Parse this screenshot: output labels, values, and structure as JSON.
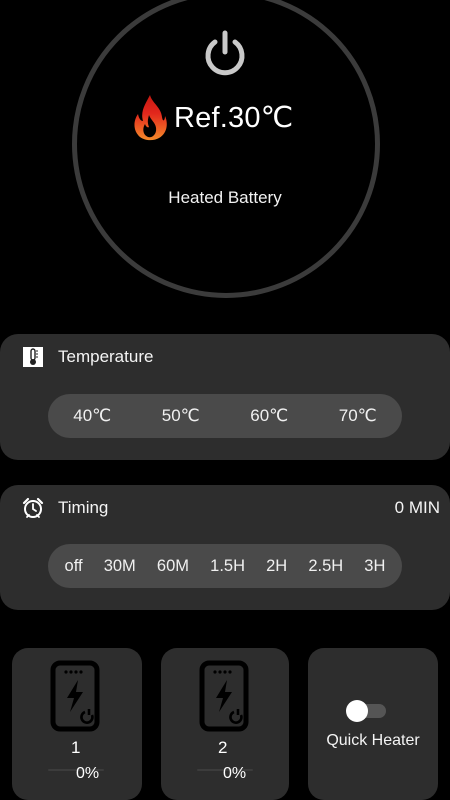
{
  "dial": {
    "reference_label": "Ref.30℃",
    "device_label": "Heated Battery",
    "power_icon": "power-icon",
    "flame_icon": "flame-icon",
    "ring_color": "#3b3b3b"
  },
  "temperature": {
    "title": "Temperature",
    "icon": "thermometer-icon",
    "options": [
      "40℃",
      "50℃",
      "60℃",
      "70℃"
    ]
  },
  "timing": {
    "title": "Timing",
    "icon": "alarm-clock-icon",
    "value": "0 MIN",
    "options": [
      "off",
      "30M",
      "60M",
      "1.5H",
      "2H",
      "2.5H",
      "3H"
    ]
  },
  "batteries": [
    {
      "number": "1",
      "percent": "0%",
      "level": 0,
      "icon": "battery-charging-icon"
    },
    {
      "number": "2",
      "percent": "0%",
      "level": 0,
      "icon": "battery-charging-icon"
    }
  ],
  "quick_heater": {
    "label": "Quick Heater",
    "enabled": false
  },
  "colors": {
    "background": "#000000",
    "panel": "#2d2d2d",
    "pill": "#4a4a4a",
    "flame_red": "#e2261c",
    "flame_orange": "#f58a2a"
  }
}
